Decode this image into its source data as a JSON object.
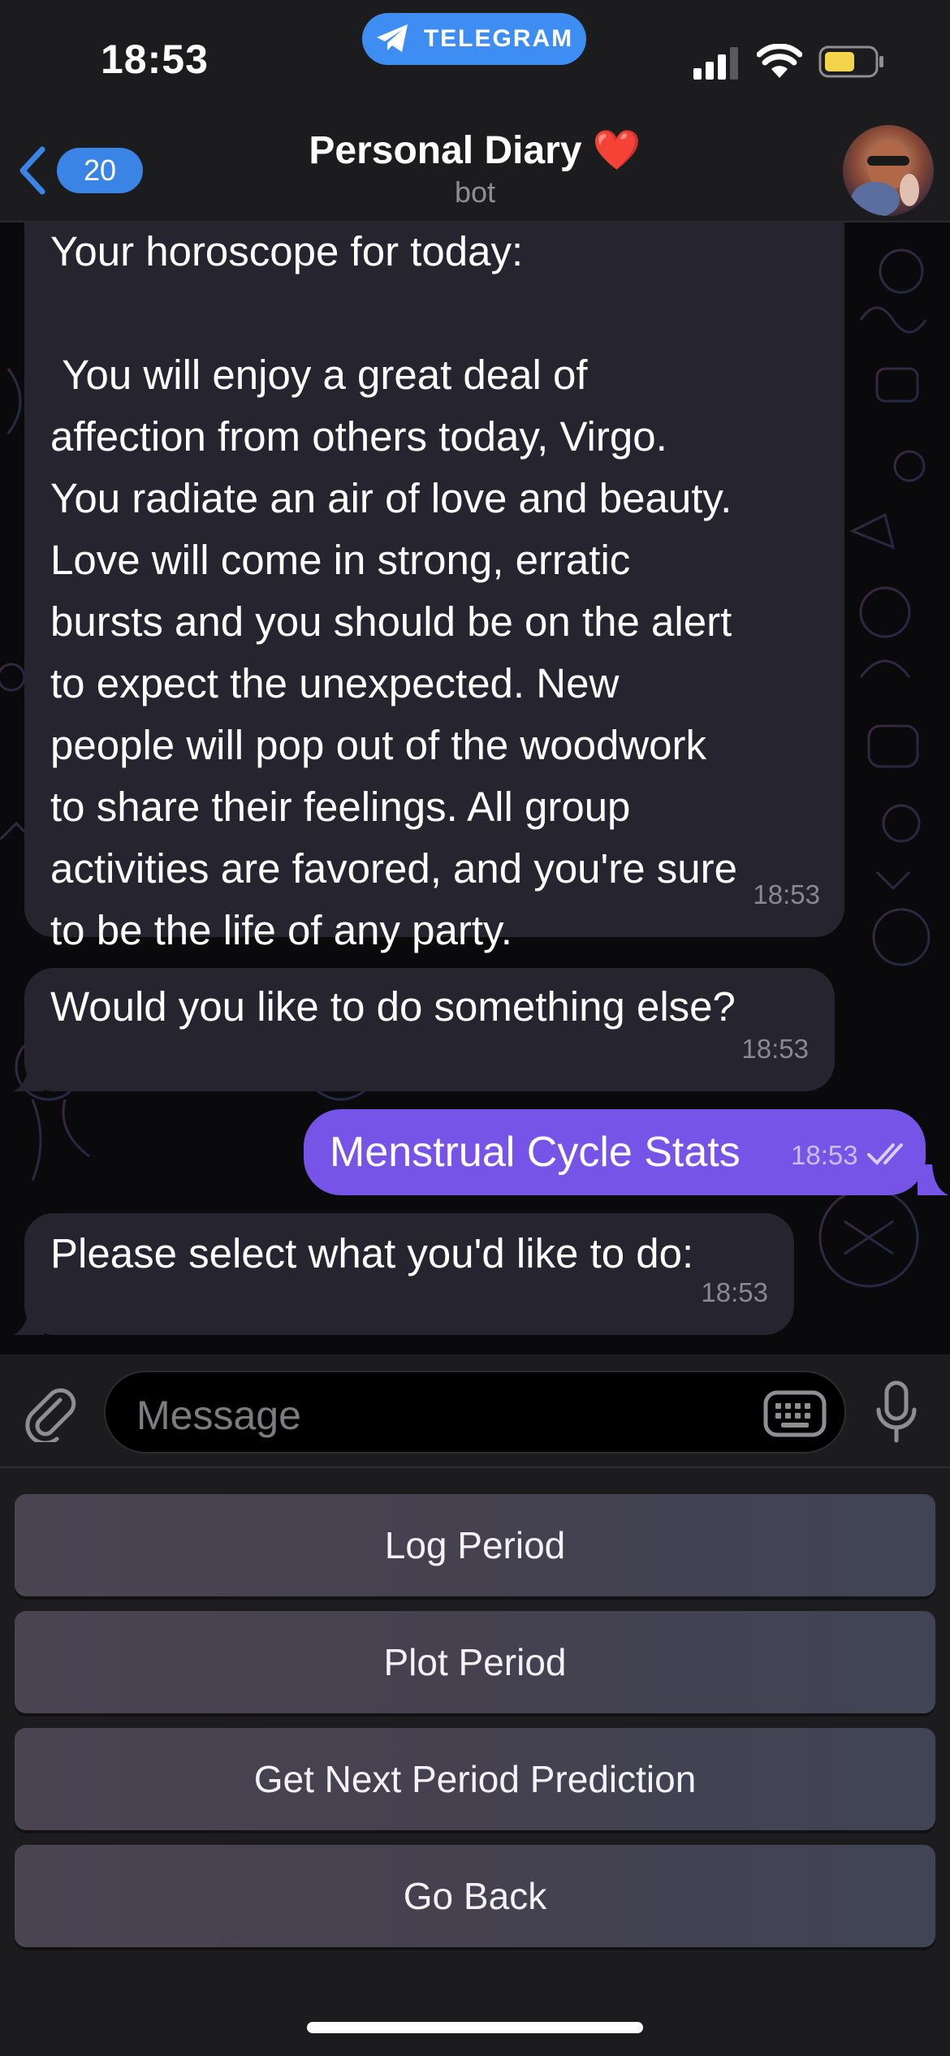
{
  "status_bar": {
    "time": "18:53",
    "app_pill": "TELEGRAM"
  },
  "header": {
    "back_count": "20",
    "title": "Personal Diary ❤️",
    "subtitle": "bot"
  },
  "messages": [
    {
      "direction": "incoming",
      "text": "Your horoscope for today:\n\n You will enjoy a great deal of\naffection from others today, Virgo.\nYou radiate an air of love and beauty.\nLove will come in strong, erratic\nbursts and you should be on the alert\nto expect the unexpected. New\npeople will pop out of the woodwork\nto share their feelings. All group\nactivities are favored, and you're sure\nto be the life of any party.",
      "time": "18:53"
    },
    {
      "direction": "incoming",
      "text": "Would you like to do something else?",
      "time": "18:53"
    },
    {
      "direction": "outgoing",
      "text": "Menstrual Cycle Stats",
      "time": "18:53",
      "status": "read"
    },
    {
      "direction": "incoming",
      "text": "Please select what you'd like to do:",
      "time": "18:53"
    }
  ],
  "input": {
    "placeholder": "Message"
  },
  "keyboard_buttons": [
    "Log Period",
    "Plot Period",
    "Get Next Period Prediction",
    "Go Back"
  ],
  "colors": {
    "accent": "#3a84e6",
    "outgoing_bubble": "#7654e8",
    "incoming_bubble": "#26242e",
    "bar_background": "#1c1c1e"
  }
}
